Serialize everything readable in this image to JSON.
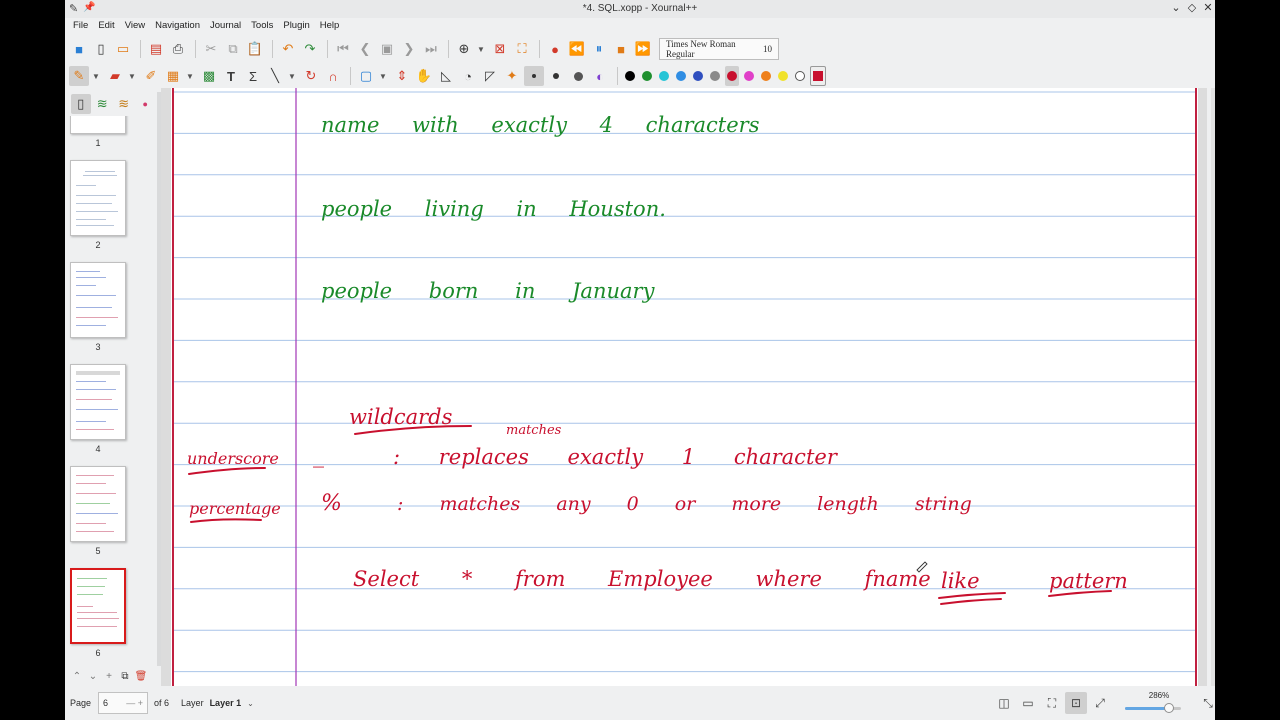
{
  "window": {
    "title": "*4. SQL.xopp - Xournal++",
    "controls": [
      "minimize",
      "restore",
      "close"
    ]
  },
  "menubar": [
    "File",
    "Edit",
    "View",
    "Navigation",
    "Journal",
    "Tools",
    "Plugin",
    "Help"
  ],
  "toolbar": {
    "font_name": "Times New Roman Regular",
    "font_size": "10"
  },
  "palette": {
    "colors": [
      "#000000",
      "#1e8f2e",
      "#25c4d6",
      "#2f8de3",
      "#2f4fbf",
      "#8a8a8a",
      "#c8102e",
      "#e040c8",
      "#ee7f1a",
      "#f0e22b",
      "#ffffff"
    ],
    "selected_index": 6,
    "current_color": "#c8102e"
  },
  "sidebar": {
    "thumbnails": [
      {
        "label": "1"
      },
      {
        "label": "2"
      },
      {
        "label": "3"
      },
      {
        "label": "4"
      },
      {
        "label": "5"
      },
      {
        "label": "6",
        "active": true
      }
    ]
  },
  "page": {
    "ink_green": "#1a8a2a",
    "ink_red": "#c8102e",
    "green_lines": [
      "name with exactly 4 characters",
      "people living in Houston.",
      "people born in January"
    ],
    "red_notes": {
      "heading": "wildcards",
      "matches_note": "matches",
      "underscore_label": "underscore",
      "underscore_symbol": "_",
      "underscore_desc": ": replaces exactly 1 character",
      "percentage_label": "percentage",
      "percentage_symbol": "%",
      "percentage_desc": ": matches any 0 or more length string",
      "query": "Select * from Employee where fname",
      "query_keyword": "like",
      "query_pattern": "pattern"
    }
  },
  "statusbar": {
    "page_label": "Page",
    "page_number": "6",
    "of_label": "of 6",
    "layer_label": "Layer",
    "layer_name": "Layer 1",
    "zoom": "286%",
    "zoom_fraction": 0.78
  }
}
